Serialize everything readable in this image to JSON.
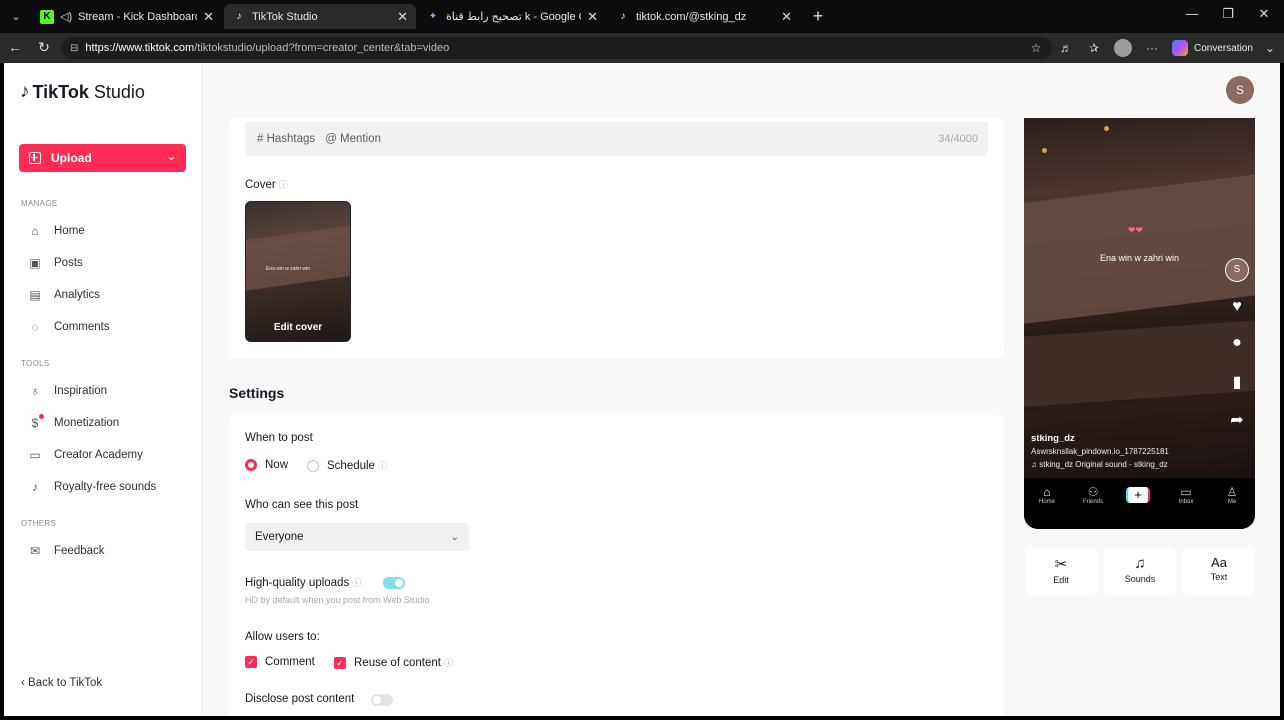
{
  "browser": {
    "tabs": [
      {
        "title": "Stream - Kick Dashboard",
        "icon": "K",
        "active": false
      },
      {
        "title": "TikTok Studio",
        "icon": "♪",
        "active": true
      },
      {
        "title": "تصحيح رابط قناة k - Google Gemini",
        "icon": "✦",
        "active": false
      },
      {
        "title": "tiktok.com/@stking_dz",
        "icon": "♪",
        "active": false
      }
    ],
    "url_host": "https://www.tiktok.com",
    "url_path": "/tiktokstudio/upload?from=creator_center&tab=video",
    "copilot_label": "Conversation"
  },
  "brand": {
    "name": "TikTok",
    "suffix": "Studio"
  },
  "sidebar": {
    "upload_label": "Upload",
    "manage_label": "MANAGE",
    "manage_items": [
      {
        "label": "Home",
        "icon": "home-icon"
      },
      {
        "label": "Posts",
        "icon": "posts-icon"
      },
      {
        "label": "Analytics",
        "icon": "analytics-icon"
      },
      {
        "label": "Comments",
        "icon": "comments-icon"
      }
    ],
    "tools_label": "TOOLS",
    "tools_items": [
      {
        "label": "Inspiration",
        "icon": "lightbulb-icon"
      },
      {
        "label": "Monetization",
        "icon": "dollar-icon"
      },
      {
        "label": "Creator Academy",
        "icon": "academy-icon"
      },
      {
        "label": "Royalty-free sounds",
        "icon": "music-note-icon"
      }
    ],
    "others_label": "OTHERS",
    "others_items": [
      {
        "label": "Feedback",
        "icon": "mail-icon"
      }
    ],
    "back_label": "‹ Back to TikTok"
  },
  "user": {
    "avatar_letter": "S"
  },
  "caption": {
    "hashtags": "# Hashtags",
    "mention": "@ Mention",
    "count": "34/4000"
  },
  "cover": {
    "label": "Cover",
    "edit_label": "Edit cover",
    "thumb_text": "Ena win w zahri win"
  },
  "settings": {
    "title": "Settings",
    "when_label": "When to post",
    "now_label": "Now",
    "schedule_label": "Schedule",
    "who_label": "Who can see this post",
    "who_value": "Everyone",
    "hq_label": "High-quality uploads",
    "hq_sub": "HD by default when you post from Web Studio",
    "allow_label": "Allow users to:",
    "comment_label": "Comment",
    "reuse_label": "Reuse of content",
    "disclose_label": "Disclose post content"
  },
  "preview": {
    "overlay_text": "Ena win w zahri win",
    "username": "stking_dz",
    "caption": "Aswrsknsllak_pindown.io_1787225181",
    "sound": "♫ stking_dz   Original sound - stking_dz",
    "avatar_letter": "S",
    "nav": [
      "Home",
      "Friends",
      "Inbox",
      "Me"
    ]
  },
  "tools": [
    {
      "label": "Edit",
      "icon": "scissors-icon"
    },
    {
      "label": "Sounds",
      "icon": "music-icon"
    },
    {
      "label": "Text",
      "icon": "text-icon"
    }
  ]
}
